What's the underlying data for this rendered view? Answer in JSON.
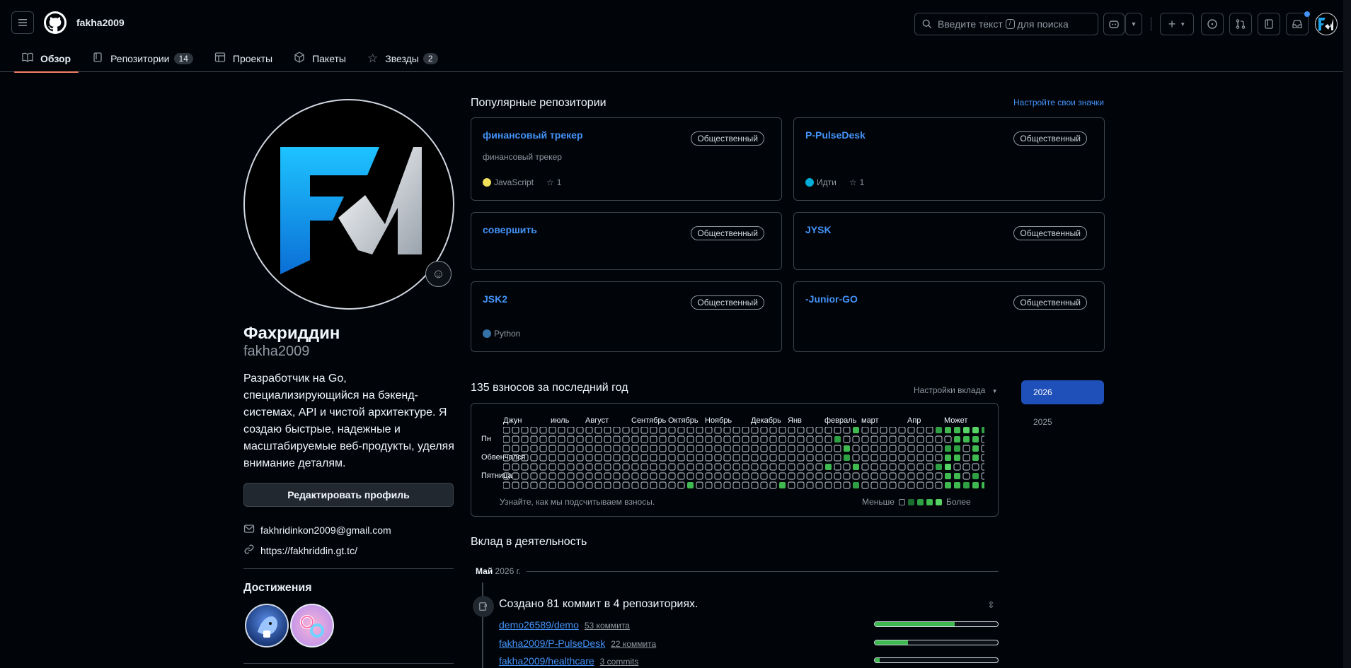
{
  "header": {
    "username": "fakha2009",
    "search_placeholder_a": "Введите текст",
    "search_key": "/",
    "search_placeholder_b": "для поиска"
  },
  "nav": {
    "tabs": [
      {
        "label": "Обзор",
        "icon": "book-icon",
        "selected": true
      },
      {
        "label": "Репозитории",
        "icon": "repo-icon",
        "count": "14"
      },
      {
        "label": "Проекты",
        "icon": "table-icon"
      },
      {
        "label": "Пакеты",
        "icon": "package-icon"
      },
      {
        "label": "Звезды",
        "icon": "star-icon",
        "count": "2"
      }
    ]
  },
  "profile": {
    "fullname": "Фахриддин",
    "login": "fakha2009",
    "bio": "Разработчик на Go, специализирующийся на бэкенд-системах, API и чистой архитектуре. Я создаю быстрые, надежные и масштабируемые веб-продукты, уделяя внимание деталям.",
    "edit_label": "Редактировать профиль",
    "email": "fakhridinkon2009@gmail.com",
    "website": "https://fakhriddin.gt.tc/",
    "achievements_title": "Достижения"
  },
  "pinned": {
    "title": "Популярные репозитории",
    "customize": "Настройте свои значки",
    "repos": [
      {
        "name": "финансовый трекер",
        "visibility": "Общественный",
        "description": "финансовый трекер",
        "language": "JavaScript",
        "lang_color": "#f1e05a",
        "stars": "1"
      },
      {
        "name": "P-PulseDesk",
        "visibility": "Общественный",
        "description": "",
        "language": "Идти",
        "lang_color": "#00add8",
        "stars": "1"
      },
      {
        "name": "совершить",
        "visibility": "Общественный"
      },
      {
        "name": "JYSK",
        "visibility": "Общественный"
      },
      {
        "name": "JSK2",
        "visibility": "Общественный",
        "language": "Python",
        "lang_color": "#3572a5"
      },
      {
        "name": "-Junior-GO",
        "visibility": "Общественный"
      }
    ]
  },
  "contributions": {
    "title": "135 взносов за последний год",
    "settings": "Настройки вклада",
    "months": [
      "Джун",
      "июль",
      "Август",
      "Сентябрь",
      "Октябрь",
      "Ноябрь",
      "Декабрь",
      "Янв",
      "февраль",
      "март",
      "Апр",
      "Может"
    ],
    "days": [
      "Пн",
      "Обвенчался",
      "Пятница"
    ],
    "learn": "Узнайте, как мы подсчитываем взносы.",
    "less": "Меньше",
    "more": "Более",
    "colors": [
      "#151b23",
      "#033a16",
      "#196c2e",
      "#2ea043",
      "#56d364"
    ]
  },
  "years": [
    "2026",
    "2025"
  ],
  "activity": {
    "title": "Вклад в деятельность",
    "month": "Май",
    "year": "2026 г.",
    "summary": "Создано 81 коммит в 4 репозиториях.",
    "repos": [
      {
        "name": "demo26589/demo",
        "count": "53 коммита",
        "share": 0.65
      },
      {
        "name": "fakha2009/P-PulseDesk",
        "count": "22 коммита",
        "share": 0.27
      },
      {
        "name": "fakha2009/healthcare",
        "count": "3 commits",
        "share": 0.04
      }
    ]
  }
}
